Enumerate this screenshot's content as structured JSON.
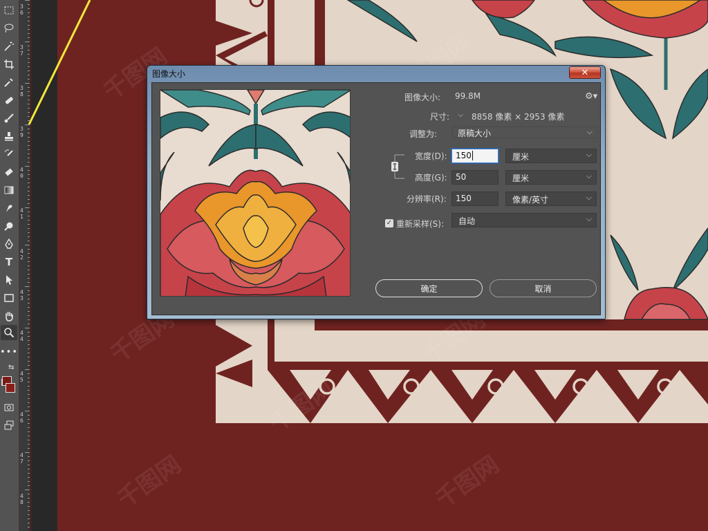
{
  "ruler": {
    "labels": [
      "3 6",
      "3 7",
      "3 8",
      "3 9",
      "4 0",
      "4 1",
      "4 2",
      "4 3",
      "4 4",
      "4 5",
      "4 6",
      "4 7",
      "4 8"
    ]
  },
  "canvas": {
    "watermark": "千图网"
  },
  "dialog": {
    "title": "图像大小",
    "close_label": "✕",
    "image_size_label": "图像大小:",
    "image_size_value": "99.8M",
    "dimensions_label": "尺寸:",
    "dimensions_value": "8858 像素  ×  2953 像素",
    "fit_to_label": "调整为:",
    "fit_to_value": "原稿大小",
    "width_label": "宽度(D):",
    "width_value": "150",
    "width_unit": "厘米",
    "height_label": "高度(G):",
    "height_value": "50",
    "height_unit": "厘米",
    "resolution_label": "分辨率(R):",
    "resolution_value": "150",
    "resolution_unit": "像素/英寸",
    "resample_label": "重新采样(S):",
    "resample_checked": true,
    "resample_value": "自动",
    "ok_label": "确定",
    "cancel_label": "取消"
  },
  "colors": {
    "canvas_red": "#6f2321",
    "pattern_cream": "#e3d5c7",
    "leaf_teal": "#2d6f70",
    "petal_red": "#c7434a",
    "petal_orange": "#e9962b",
    "foreground": "#7a1a14",
    "background": "#8a1f1a"
  }
}
